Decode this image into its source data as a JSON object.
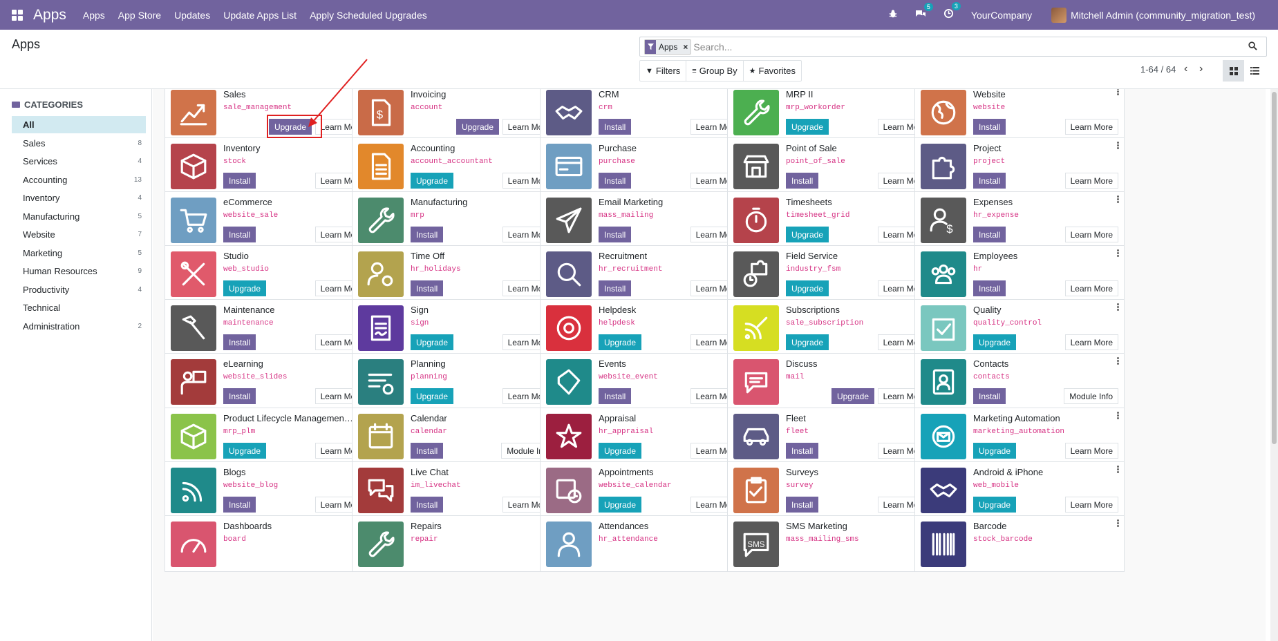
{
  "navbar": {
    "brand": "Apps",
    "menu": [
      "Apps",
      "App Store",
      "Updates",
      "Update Apps List",
      "Apply Scheduled Upgrades"
    ],
    "chat_count": "5",
    "activity_count": "3",
    "company": "YourCompany",
    "user": "Mitchell Admin (community_migration_test)"
  },
  "control_panel": {
    "title": "Apps",
    "facet_label": "Apps",
    "search_placeholder": "Search...",
    "filters": "Filters",
    "group_by": "Group By",
    "favorites": "Favorites",
    "pager": "1-64 / 64"
  },
  "sidebar": {
    "header": "CATEGORIES",
    "items": [
      {
        "label": "All",
        "count": ""
      },
      {
        "label": "Sales",
        "count": "8"
      },
      {
        "label": "Services",
        "count": "4"
      },
      {
        "label": "Accounting",
        "count": "13"
      },
      {
        "label": "Inventory",
        "count": "4"
      },
      {
        "label": "Manufacturing",
        "count": "5"
      },
      {
        "label": "Website",
        "count": "7"
      },
      {
        "label": "Marketing",
        "count": "5"
      },
      {
        "label": "Human Resources",
        "count": "9"
      },
      {
        "label": "Productivity",
        "count": "4"
      },
      {
        "label": "Technical",
        "count": ""
      },
      {
        "label": "Administration",
        "count": "2"
      }
    ]
  },
  "apps": [
    {
      "name": "Sales",
      "tech": "sale_management",
      "action": "Upgrade",
      "style": "purple",
      "more": "Learn More",
      "color": "#d0734a",
      "icon": "chart-icon"
    },
    {
      "name": "Invoicing",
      "tech": "account",
      "action": "Upgrade",
      "style": "purple",
      "more": "Learn More",
      "color": "#c96b48",
      "icon": "invoice-icon"
    },
    {
      "name": "CRM",
      "tech": "crm",
      "action": "Install",
      "style": "install",
      "more": "Learn More",
      "color": "#5d5b86",
      "icon": "handshake-icon"
    },
    {
      "name": "MRP II",
      "tech": "mrp_workorder",
      "action": "Upgrade",
      "style": "teal",
      "more": "Learn More",
      "color": "#4caf50",
      "icon": "wrench-icon"
    },
    {
      "name": "Website",
      "tech": "website",
      "action": "Install",
      "style": "install",
      "more": "Learn More",
      "color": "#d0734a",
      "icon": "globe-icon"
    },
    {
      "name": "Inventory",
      "tech": "stock",
      "action": "Install",
      "style": "install",
      "more": "Learn More",
      "color": "#b5434b",
      "icon": "box-icon"
    },
    {
      "name": "Accounting",
      "tech": "account_accountant",
      "action": "Upgrade",
      "style": "teal",
      "more": "Learn More",
      "color": "#e2882b",
      "icon": "document-icon"
    },
    {
      "name": "Purchase",
      "tech": "purchase",
      "action": "Install",
      "style": "install",
      "more": "Learn More",
      "color": "#6f9ec2",
      "icon": "card-icon"
    },
    {
      "name": "Point of Sale",
      "tech": "point_of_sale",
      "action": "Install",
      "style": "install",
      "more": "Learn More",
      "color": "#595959",
      "icon": "shop-icon"
    },
    {
      "name": "Project",
      "tech": "project",
      "action": "Install",
      "style": "install",
      "more": "Learn More",
      "color": "#5d5b86",
      "icon": "puzzle-icon"
    },
    {
      "name": "eCommerce",
      "tech": "website_sale",
      "action": "Install",
      "style": "install",
      "more": "Learn More",
      "color": "#6f9ec2",
      "icon": "cart-icon"
    },
    {
      "name": "Manufacturing",
      "tech": "mrp",
      "action": "Install",
      "style": "install",
      "more": "Learn More",
      "color": "#4c8b6d",
      "icon": "wrench-icon"
    },
    {
      "name": "Email Marketing",
      "tech": "mass_mailing",
      "action": "Install",
      "style": "install",
      "more": "Learn More",
      "color": "#595959",
      "icon": "paper-plane-icon"
    },
    {
      "name": "Timesheets",
      "tech": "timesheet_grid",
      "action": "Upgrade",
      "style": "teal",
      "more": "Learn More",
      "color": "#b5434b",
      "icon": "stopwatch-icon"
    },
    {
      "name": "Expenses",
      "tech": "hr_expense",
      "action": "Install",
      "style": "install",
      "more": "Learn More",
      "color": "#595959",
      "icon": "user-dollar-icon"
    },
    {
      "name": "Studio",
      "tech": "web_studio",
      "action": "Upgrade",
      "style": "teal",
      "more": "Learn More",
      "color": "#e05a6b",
      "icon": "tools-icon"
    },
    {
      "name": "Time Off",
      "tech": "hr_holidays",
      "action": "Install",
      "style": "install",
      "more": "Learn More",
      "color": "#b3a34e",
      "icon": "user-gear-icon"
    },
    {
      "name": "Recruitment",
      "tech": "hr_recruitment",
      "action": "Install",
      "style": "install",
      "more": "Learn More",
      "color": "#5d5b86",
      "icon": "magnifier-icon"
    },
    {
      "name": "Field Service",
      "tech": "industry_fsm",
      "action": "Upgrade",
      "style": "teal",
      "more": "Learn More",
      "color": "#595959",
      "icon": "puzzle-clock-icon"
    },
    {
      "name": "Employees",
      "tech": "hr",
      "action": "Install",
      "style": "install",
      "more": "Learn More",
      "color": "#1f8a8a",
      "icon": "users-icon"
    },
    {
      "name": "Maintenance",
      "tech": "maintenance",
      "action": "Install",
      "style": "install",
      "more": "Learn More",
      "color": "#595959",
      "icon": "hammer-icon"
    },
    {
      "name": "Sign",
      "tech": "sign",
      "action": "Upgrade",
      "style": "teal",
      "more": "Learn More",
      "color": "#5e3a9e",
      "icon": "sign-icon"
    },
    {
      "name": "Helpdesk",
      "tech": "helpdesk",
      "action": "Upgrade",
      "style": "teal",
      "more": "Learn More",
      "color": "#d9303d",
      "icon": "lifebuoy-icon"
    },
    {
      "name": "Subscriptions",
      "tech": "sale_subscription",
      "action": "Upgrade",
      "style": "teal",
      "more": "Learn More",
      "color": "#d6de22",
      "icon": "rss-pen-icon"
    },
    {
      "name": "Quality",
      "tech": "quality_control",
      "action": "Upgrade",
      "style": "teal",
      "more": "Learn More",
      "color": "#7ac7bf",
      "icon": "check-board-icon"
    },
    {
      "name": "eLearning",
      "tech": "website_slides",
      "action": "Install",
      "style": "install",
      "more": "Learn More",
      "color": "#a33b3b",
      "icon": "teacher-icon"
    },
    {
      "name": "Planning",
      "tech": "planning",
      "action": "Upgrade",
      "style": "teal",
      "more": "Learn More",
      "color": "#2a7f7f",
      "icon": "planning-icon"
    },
    {
      "name": "Events",
      "tech": "website_event",
      "action": "Install",
      "style": "install",
      "more": "Learn More",
      "color": "#1f8a8a",
      "icon": "ticket-icon"
    },
    {
      "name": "Discuss",
      "tech": "mail",
      "action": "Upgrade",
      "style": "purple",
      "more": "Learn More",
      "color": "#d9556f",
      "icon": "chat-icon"
    },
    {
      "name": "Contacts",
      "tech": "contacts",
      "action": "Install",
      "style": "install",
      "more": "Module Info",
      "color": "#1f8a8a",
      "icon": "contact-book-icon"
    },
    {
      "name": "Product Lifecycle Managemen…",
      "tech": "mrp_plm",
      "action": "Upgrade",
      "style": "teal",
      "more": "Learn More",
      "color": "#8bc34a",
      "icon": "cube-icon"
    },
    {
      "name": "Calendar",
      "tech": "calendar",
      "action": "Install",
      "style": "install",
      "more": "Module Info",
      "color": "#b3a34e",
      "icon": "calendar-icon"
    },
    {
      "name": "Appraisal",
      "tech": "hr_appraisal",
      "action": "Upgrade",
      "style": "teal",
      "more": "Learn More",
      "color": "#9c1f3f",
      "icon": "star-icon"
    },
    {
      "name": "Fleet",
      "tech": "fleet",
      "action": "Install",
      "style": "install",
      "more": "Learn More",
      "color": "#5d5b86",
      "icon": "car-icon"
    },
    {
      "name": "Marketing Automation",
      "tech": "marketing_automation",
      "action": "Upgrade",
      "style": "teal",
      "more": "Learn More",
      "color": "#17a2b8",
      "icon": "gear-mail-icon"
    },
    {
      "name": "Blogs",
      "tech": "website_blog",
      "action": "Install",
      "style": "install",
      "more": "Learn More",
      "color": "#1f8a8a",
      "icon": "rss-icon"
    },
    {
      "name": "Live Chat",
      "tech": "im_livechat",
      "action": "Install",
      "style": "install",
      "more": "Learn More",
      "color": "#a33b3b",
      "icon": "chat-bubbles-icon"
    },
    {
      "name": "Appointments",
      "tech": "website_calendar",
      "action": "Upgrade",
      "style": "teal",
      "more": "Learn More",
      "color": "#9b6b85",
      "icon": "calendar-clock-icon"
    },
    {
      "name": "Surveys",
      "tech": "survey",
      "action": "Install",
      "style": "install",
      "more": "Learn More",
      "color": "#d0734a",
      "icon": "clipboard-icon"
    },
    {
      "name": "Android & iPhone",
      "tech": "web_mobile",
      "action": "Upgrade",
      "style": "teal",
      "more": "Learn More",
      "color": "#3b3b7a",
      "icon": "handshake-icon"
    },
    {
      "name": "Dashboards",
      "tech": "board",
      "action": "",
      "style": "",
      "more": "",
      "color": "#d9556f",
      "icon": "gauge-icon"
    },
    {
      "name": "Repairs",
      "tech": "repair",
      "action": "",
      "style": "",
      "more": "",
      "color": "#4c8b6d",
      "icon": "wrench-icon"
    },
    {
      "name": "Attendances",
      "tech": "hr_attendance",
      "action": "",
      "style": "",
      "more": "",
      "color": "#6f9ec2",
      "icon": "user-icon"
    },
    {
      "name": "SMS Marketing",
      "tech": "mass_mailing_sms",
      "action": "",
      "style": "",
      "more": "",
      "color": "#595959",
      "icon": "sms-icon"
    },
    {
      "name": "Barcode",
      "tech": "stock_barcode",
      "action": "",
      "style": "",
      "more": "",
      "color": "#3b3b7a",
      "icon": "barcode-icon"
    }
  ]
}
